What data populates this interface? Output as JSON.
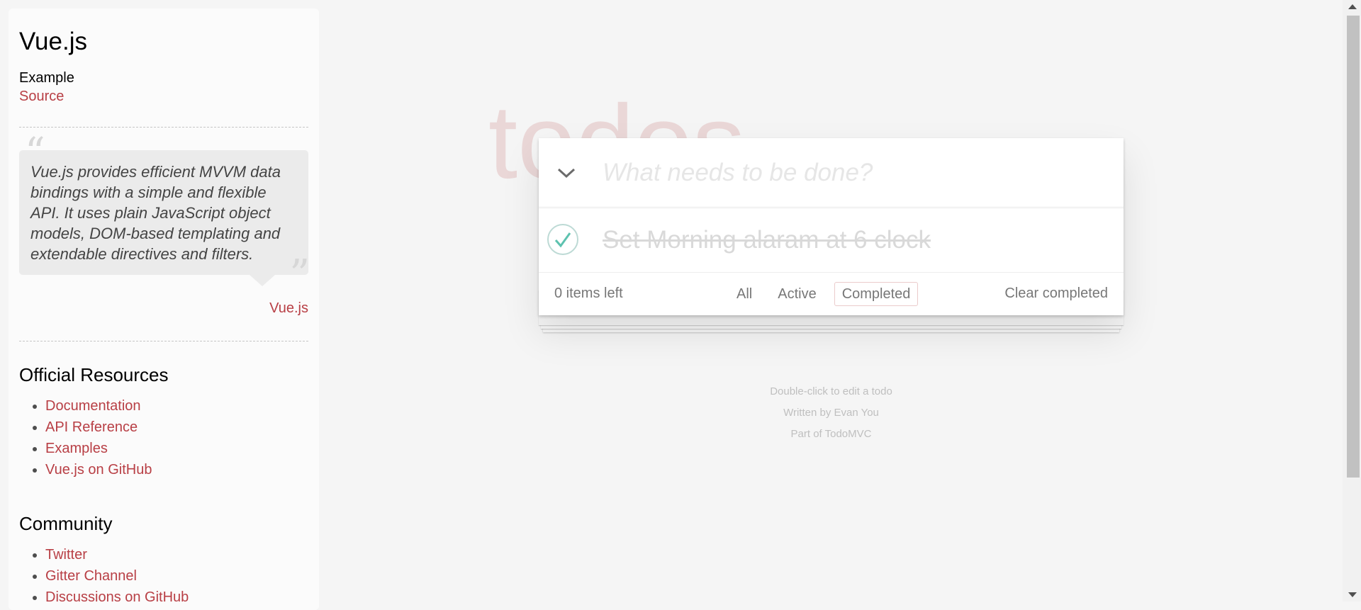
{
  "sidebar": {
    "title": "Vue.js",
    "subtitle": "Example",
    "source_link": "Source",
    "quote": "Vue.js provides efficient MVVM data bindings with a simple and flexible API. It uses plain JavaScript object models, DOM-based templating and extendable directives and filters.",
    "quote_open": "“",
    "quote_close": "”",
    "quote_author": "Vue.js",
    "official_heading": "Official Resources",
    "official_links": [
      "Documentation",
      "API Reference",
      "Examples",
      "Vue.js on GitHub"
    ],
    "community_heading": "Community",
    "community_links": [
      "Twitter",
      "Gitter Channel",
      "Discussions on GitHub"
    ]
  },
  "app": {
    "title": "todos",
    "new_todo_placeholder": "What needs to be done?",
    "toggle_all_icon": "chevron-down-icon",
    "todos": [
      {
        "title": "Set Morning alaram at 6 clock",
        "completed": true
      }
    ],
    "footer": {
      "count": "0 items left",
      "filters": [
        "All",
        "Active",
        "Completed"
      ],
      "selected_filter": "Completed",
      "clear": "Clear completed"
    }
  },
  "info": {
    "line1": "Double-click to edit a todo",
    "line2": "Written by Evan You",
    "line3": "Part of TodoMVC"
  },
  "colors": {
    "accent": "#b83f45",
    "title": "#eaddde",
    "check": "#5dc2af"
  }
}
